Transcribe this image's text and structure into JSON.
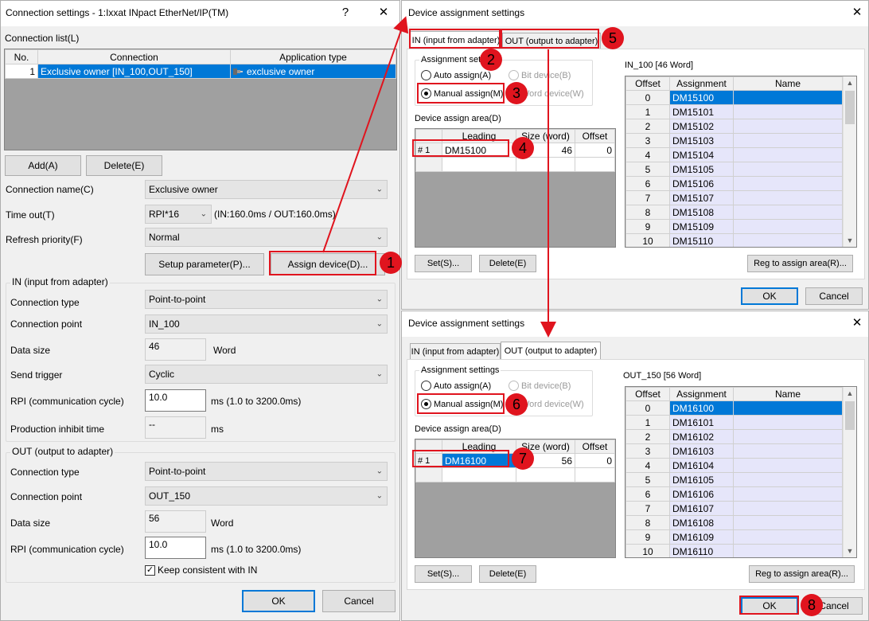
{
  "left": {
    "title": "Connection settings  - 1:Ixxat INpact EtherNet/IP(TM)",
    "help": "?",
    "close": "✕",
    "conn_list_label": "Connection list(L)",
    "cols": [
      "No.",
      "Connection",
      "Application type"
    ],
    "rows": [
      {
        "no": "1",
        "connection": "Exclusive owner [IN_100,OUT_150]",
        "type": "exclusive owner"
      }
    ],
    "add": "Add(A)",
    "delete": "Delete(E)",
    "conn_name_label": "Connection name(C)",
    "conn_name_value": "Exclusive owner",
    "timeout_label": "Time out(T)",
    "timeout_value": "RPI*16",
    "timeout_info": "(IN:160.0ms / OUT:160.0ms)",
    "refresh_label": "Refresh priority(F)",
    "refresh_value": "Normal",
    "setup_param": "Setup parameter(P)...",
    "assign_device": "Assign device(D)...",
    "in_group": "IN (input from adapter)",
    "in_conn_type_label": "Connection type",
    "in_conn_type_value": "Point-to-point",
    "in_conn_point_label": "Connection point",
    "in_conn_point_value": "IN_100",
    "in_data_size_label": "Data size",
    "in_data_size_value": "46",
    "in_data_size_unit": "Word",
    "send_trigger_label": "Send trigger",
    "send_trigger_value": "Cyclic",
    "in_rpi_label": "RPI (communication cycle)",
    "in_rpi_value": "10.0",
    "in_rpi_unit": "ms   (1.0 to 3200.0ms)",
    "prod_inhibit_label": "Production inhibit time",
    "prod_inhibit_value": "--",
    "prod_inhibit_unit": "ms",
    "out_group": "OUT (output to adapter)",
    "out_conn_type_label": "Connection type",
    "out_conn_type_value": "Point-to-point",
    "out_conn_point_label": "Connection point",
    "out_conn_point_value": "OUT_150",
    "out_data_size_label": "Data size",
    "out_data_size_value": "56",
    "out_data_size_unit": "Word",
    "out_rpi_label": "RPI (communication cycle)",
    "out_rpi_value": "10.0",
    "out_rpi_unit": "ms   (1.0 to 3200.0ms)",
    "keep_consistent": "Keep consistent with IN",
    "ok": "OK",
    "cancel": "Cancel"
  },
  "dlg1": {
    "title": "Device assignment settings",
    "close": "✕",
    "tab_in": "IN (input from adapter)",
    "tab_out": "OUT (output to adapter)",
    "assign_settings": "Assignment settings",
    "auto": "Auto assign(A)",
    "bit": "Bit device(B)",
    "manual": "Manual assign(M)",
    "word": "Word device(W)",
    "area_label": "Device assign area(D)",
    "area_cols": [
      "Leading",
      "Size (word)",
      "Offset"
    ],
    "area_row": {
      "no": "# 1",
      "leading": "DM15100",
      "size": "46",
      "offset": "0"
    },
    "table_title": "IN_100 [46 Word]",
    "table_cols": [
      "Offset",
      "Assignment",
      "Name"
    ],
    "rows": [
      {
        "offset": "0",
        "assign": "DM15100"
      },
      {
        "offset": "1",
        "assign": "DM15101"
      },
      {
        "offset": "2",
        "assign": "DM15102"
      },
      {
        "offset": "3",
        "assign": "DM15103"
      },
      {
        "offset": "4",
        "assign": "DM15104"
      },
      {
        "offset": "5",
        "assign": "DM15105"
      },
      {
        "offset": "6",
        "assign": "DM15106"
      },
      {
        "offset": "7",
        "assign": "DM15107"
      },
      {
        "offset": "8",
        "assign": "DM15108"
      },
      {
        "offset": "9",
        "assign": "DM15109"
      },
      {
        "offset": "10",
        "assign": "DM15110"
      }
    ],
    "set": "Set(S)...",
    "delete": "Delete(E)",
    "reg": "Reg to assign area(R)...",
    "ok": "OK",
    "cancel": "Cancel"
  },
  "dlg2": {
    "title": "Device assignment settings",
    "close": "✕",
    "tab_in": "IN (input from adapter)",
    "tab_out": "OUT (output to adapter)",
    "assign_settings": "Assignment settings",
    "auto": "Auto assign(A)",
    "bit": "Bit device(B)",
    "manual": "Manual assign(M)",
    "word": "Word device(W)",
    "area_label": "Device assign area(D)",
    "area_cols": [
      "Leading",
      "Size (word)",
      "Offset"
    ],
    "area_row": {
      "no": "# 1",
      "leading": "DM16100",
      "size": "56",
      "offset": "0"
    },
    "table_title": "OUT_150 [56 Word]",
    "table_cols": [
      "Offset",
      "Assignment",
      "Name"
    ],
    "rows": [
      {
        "offset": "0",
        "assign": "DM16100"
      },
      {
        "offset": "1",
        "assign": "DM16101"
      },
      {
        "offset": "2",
        "assign": "DM16102"
      },
      {
        "offset": "3",
        "assign": "DM16103"
      },
      {
        "offset": "4",
        "assign": "DM16104"
      },
      {
        "offset": "5",
        "assign": "DM16105"
      },
      {
        "offset": "6",
        "assign": "DM16106"
      },
      {
        "offset": "7",
        "assign": "DM16107"
      },
      {
        "offset": "8",
        "assign": "DM16108"
      },
      {
        "offset": "9",
        "assign": "DM16109"
      },
      {
        "offset": "10",
        "assign": "DM16110"
      }
    ],
    "set": "Set(S)...",
    "delete": "Delete(E)",
    "reg": "Reg to assign area(R)...",
    "ok": "OK",
    "cancel": "Cancel"
  },
  "markers": [
    "1",
    "2",
    "3",
    "4",
    "5",
    "6",
    "7",
    "8"
  ],
  "colors": {
    "highlight_red": "#e0141e",
    "selection_blue": "#0078d7",
    "cell_lavender": "#e6e6fa",
    "list_gray": "#a0a0a0"
  }
}
